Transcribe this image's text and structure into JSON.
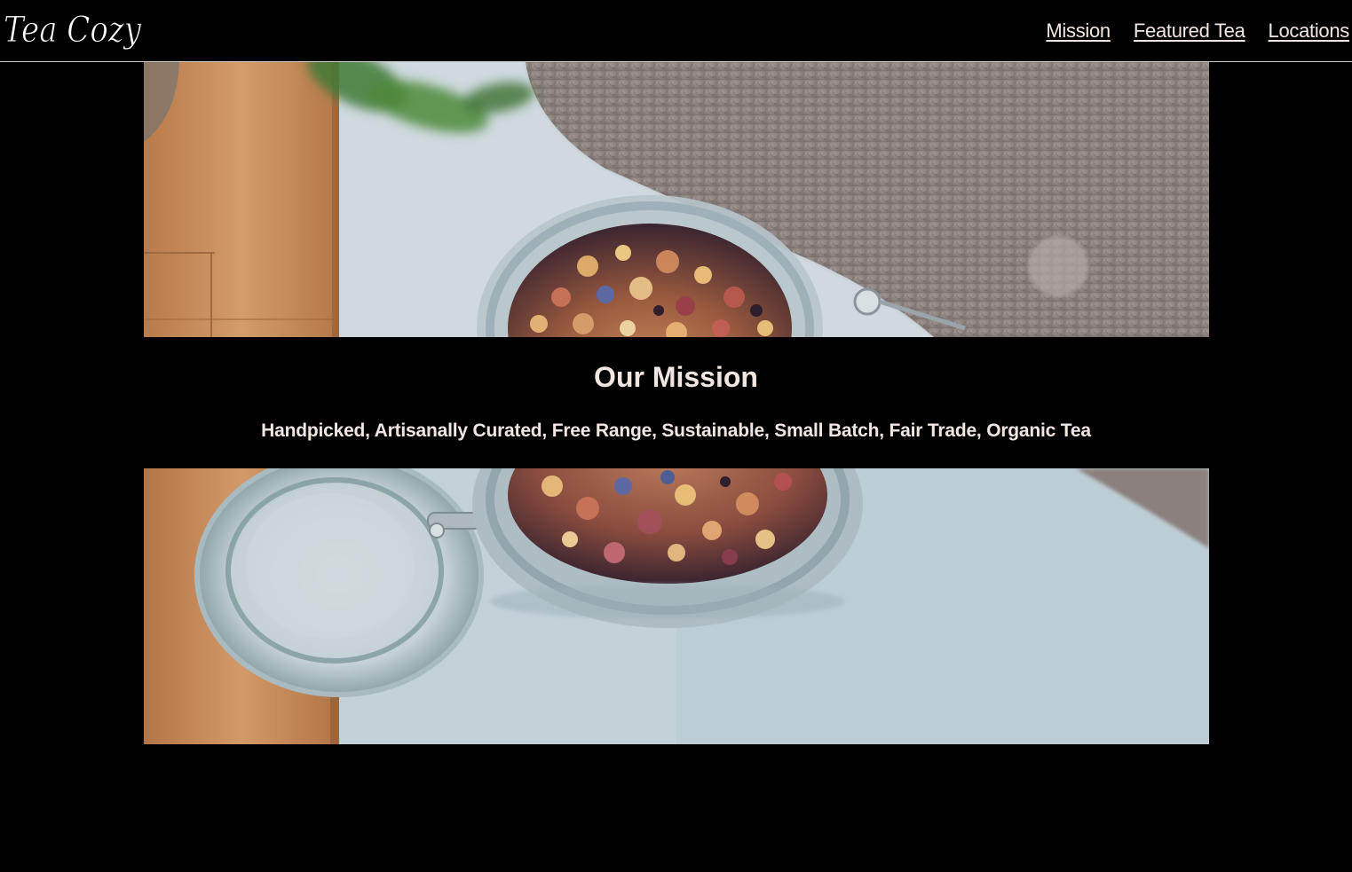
{
  "header": {
    "logo_text": "Tea Cozy",
    "nav": [
      {
        "label": "Mission"
      },
      {
        "label": "Featured Tea"
      },
      {
        "label": "Locations"
      }
    ]
  },
  "mission": {
    "title": "Our Mission",
    "tagline": "Handpicked, Artisanally Curated, Free Range, Sustainable, Small Batch, Fair Trade, Organic Tea"
  },
  "colors": {
    "background": "#000000",
    "text": "#f1e6e2",
    "header_border": "#c9c9c9"
  }
}
